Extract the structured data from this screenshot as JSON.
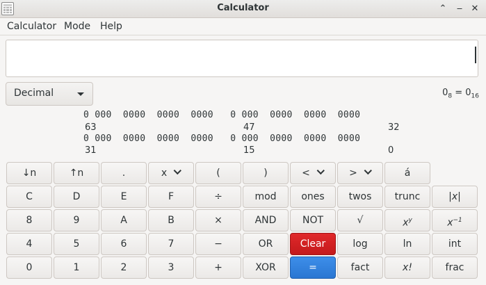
{
  "window": {
    "title": "Calculator"
  },
  "menu": {
    "items": [
      "Calculator",
      "Mode",
      "Help"
    ]
  },
  "display": {
    "value": ""
  },
  "base": {
    "selected": "Decimal"
  },
  "conversion": {
    "left": "0",
    "left_base": "8",
    "eq": " = ",
    "right": "0",
    "right_base": "16"
  },
  "bits": {
    "row1": "0 000  0000  0000  0000   0 000  0000  0000  0000",
    "row1_labels": [
      "63",
      "47",
      "32"
    ],
    "row2": "0 000  0000  0000  0000   0 000  0000  0000  0000",
    "row2_labels": [
      "31",
      "15",
      "0"
    ]
  },
  "buttons": {
    "r0": [
      "↓n",
      "↑n",
      ".",
      "x",
      "(",
      ")",
      "<",
      ">",
      "á"
    ],
    "r1": [
      "C",
      "D",
      "E",
      "F",
      "÷",
      "mod",
      "ones",
      "twos",
      "trunc",
      "|x|"
    ],
    "r2": [
      "8",
      "9",
      "A",
      "B",
      "×",
      "AND",
      "NOT",
      "√",
      "x",
      "x"
    ],
    "r3": [
      "4",
      "5",
      "6",
      "7",
      "−",
      "OR",
      "Clear",
      "log",
      "ln",
      "int"
    ],
    "r4": [
      "0",
      "1",
      "2",
      "3",
      "+",
      "XOR",
      "=",
      "fact",
      "x!",
      "frac"
    ],
    "sup_y": "y",
    "sup_neg1": "−1"
  }
}
